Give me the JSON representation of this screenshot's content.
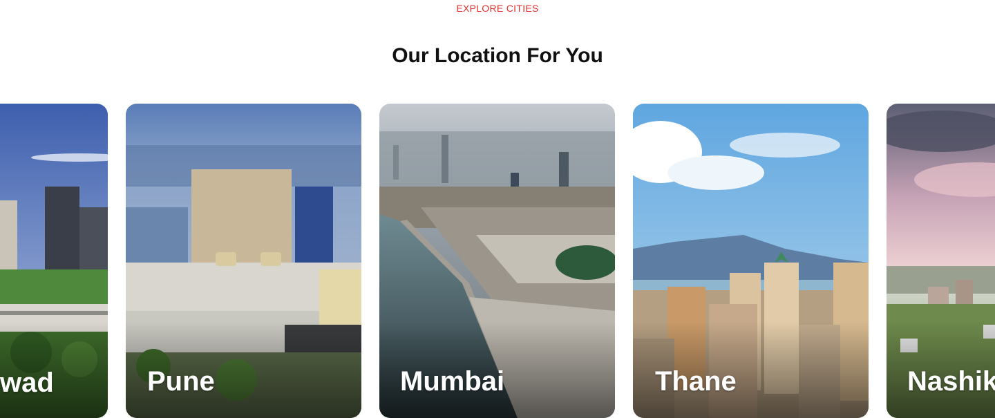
{
  "section": {
    "eyebrow": "EXPLORE CITIES",
    "title": "Our Location For You"
  },
  "cities": [
    {
      "name": "Pimpri Chinchwad",
      "visible_text": "wad"
    },
    {
      "name": "Pune"
    },
    {
      "name": "Mumbai"
    },
    {
      "name": "Thane"
    },
    {
      "name": "Nashik"
    }
  ],
  "colors": {
    "accent": "#e0312f",
    "heading": "#111111",
    "card_text": "#ffffff"
  }
}
